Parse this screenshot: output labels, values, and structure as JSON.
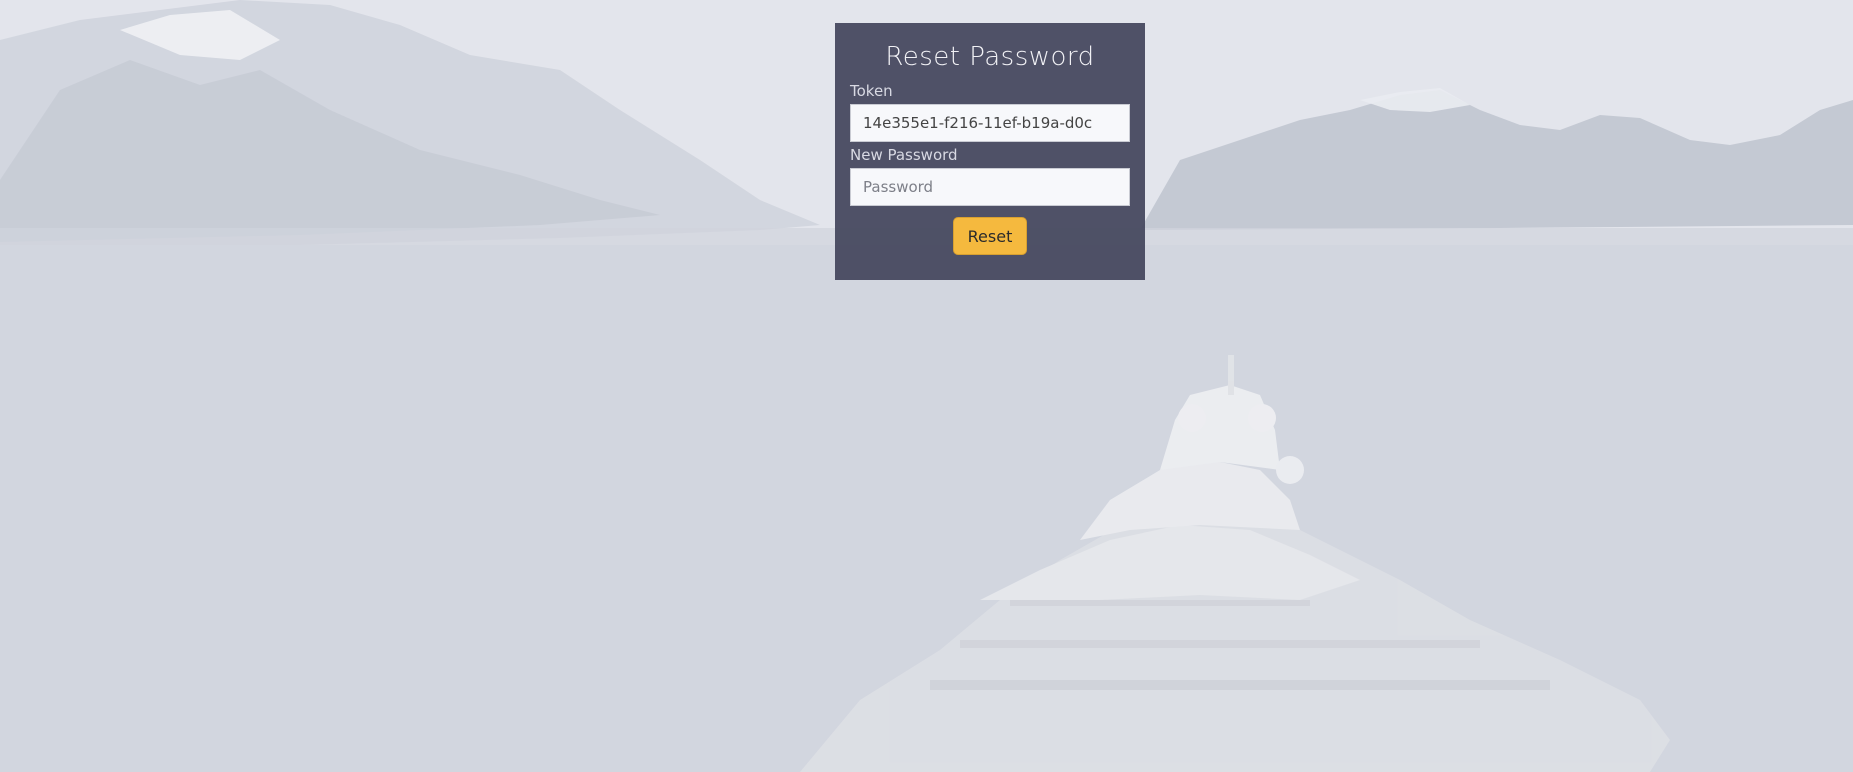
{
  "reset_form": {
    "title": "Reset Password",
    "token_label": "Token",
    "token_value": "14e355e1-f216-11ef-b19a-d0c",
    "new_password_label": "New Password",
    "new_password_placeholder": "Password",
    "reset_button_label": "Reset"
  },
  "colors": {
    "panel_background": "#44465c",
    "button_background": "#f5b93e",
    "page_background": "#d3d7e1"
  }
}
